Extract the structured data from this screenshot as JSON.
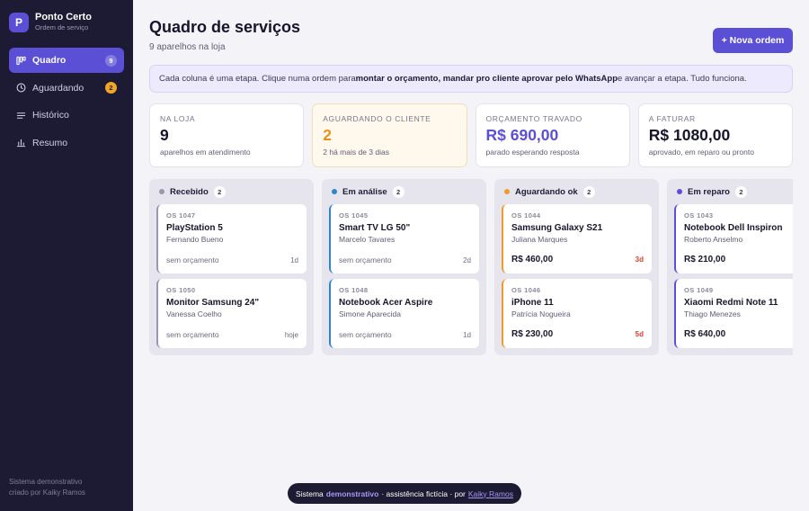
{
  "brand": {
    "logo_letter": "P",
    "name": "Ponto Certo",
    "subtitle": "Ordem de serviço"
  },
  "sidebar": {
    "items": [
      {
        "label": "Quadro",
        "badge": "9",
        "icon": "kanban-icon",
        "active": true
      },
      {
        "label": "Aguardando",
        "badge": "2",
        "icon": "clock-icon",
        "active": false
      },
      {
        "label": "Histórico",
        "badge": "",
        "icon": "list-icon",
        "active": false
      },
      {
        "label": "Resumo",
        "badge": "",
        "icon": "bar-chart-icon",
        "active": false
      }
    ],
    "footer_line1": "Sistema demonstrativo",
    "footer_line2": "criado por Kaiky Ramos"
  },
  "header": {
    "title": "Quadro de serviços",
    "subtitle": "9 aparelhos na loja",
    "new_button": "+ Nova ordem"
  },
  "info": {
    "part1": "Cada coluna é uma etapa. Clique numa ordem para ",
    "bold1": "montar o orçamento, mandar pro cliente aprovar pelo WhatsApp",
    "part2": " e avançar a etapa. Tudo funciona."
  },
  "stats": [
    {
      "label": "Na loja",
      "value": "9",
      "desc": "aparelhos em atendimento",
      "style": ""
    },
    {
      "label": "Aguardando o cliente",
      "value": "2",
      "desc": "2 há mais de 3 dias",
      "style": "orange"
    },
    {
      "label": "Orçamento travado",
      "value": "R$ 690,00",
      "desc": "parado esperando resposta",
      "style": "purple"
    },
    {
      "label": "A faturar",
      "value": "R$ 1080,00",
      "desc": "aprovado, em reparo ou pronto",
      "style": ""
    }
  ],
  "columns": [
    {
      "title": "Recebido",
      "count": "2",
      "dot_color": "#9a98b0",
      "cards": [
        {
          "os": "OS 1047",
          "device": "PlayStation 5",
          "client": "Fernando Bueno",
          "status": "sem orçamento",
          "age": "1d"
        },
        {
          "os": "OS 1050",
          "device": "Monitor Samsung 24\"",
          "client": "Vanessa Coelho",
          "status": "sem orçamento",
          "age": "hoje"
        }
      ]
    },
    {
      "title": "Em análise",
      "count": "2",
      "dot_color": "#2f86c9",
      "cards": [
        {
          "os": "OS 1045",
          "device": "Smart TV LG 50\"",
          "client": "Marcelo Tavares",
          "status": "sem orçamento",
          "age": "2d"
        },
        {
          "os": "OS 1048",
          "device": "Notebook Acer Aspire",
          "client": "Simone Aparecida",
          "status": "sem orçamento",
          "age": "1d"
        }
      ]
    },
    {
      "title": "Aguardando ok",
      "count": "2",
      "dot_color": "#f09a28",
      "cards": [
        {
          "os": "OS 1044",
          "device": "Samsung Galaxy S21",
          "client": "Juliana Marques",
          "price": "R$ 460,00",
          "age": "3d"
        },
        {
          "os": "OS 1046",
          "device": "iPhone 11",
          "client": "Patrícia Nogueira",
          "price": "R$ 230,00",
          "age": "5d"
        }
      ]
    },
    {
      "title": "Em reparo",
      "count": "2",
      "dot_color": "#5b4fd6",
      "cards": [
        {
          "os": "OS 1043",
          "device": "Notebook Dell Inspiron",
          "client": "Roberto Anselmo",
          "price": "R$ 210,00",
          "age": ""
        },
        {
          "os": "OS 1049",
          "device": "Xiaomi Redmi Note 11",
          "client": "Thiago Menezes",
          "price": "R$ 640,00",
          "age": ""
        }
      ]
    }
  ],
  "toast": {
    "prefix": "Sistema",
    "highlight": "demonstrativo",
    "middle": "· assistência fictícia · por",
    "link": "Kaiky Ramos"
  }
}
